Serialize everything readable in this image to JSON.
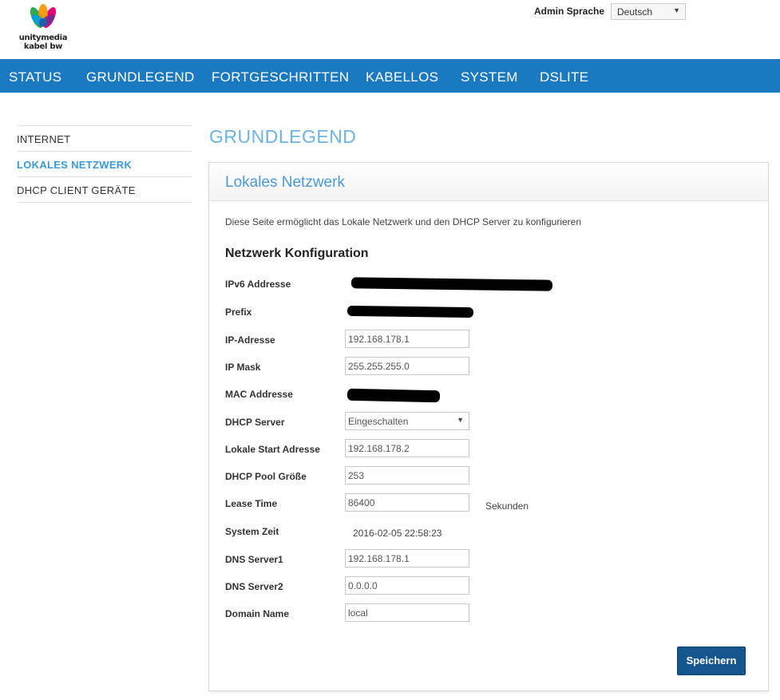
{
  "header": {
    "brand_line1": "unitymedia",
    "brand_line2": "kabel bw",
    "admin_language_label": "Admin Sprache",
    "admin_language_value": "Deutsch"
  },
  "nav": {
    "items": [
      "STATUS",
      "GRUNDLEGEND",
      "FORTGESCHRITTEN",
      "KABELLOS",
      "SYSTEM",
      "DSLITE"
    ],
    "active": "GRUNDLEGEND"
  },
  "sidebar": {
    "items": [
      "INTERNET",
      "LOKALES NETZWERK",
      "DHCP CLIENT GERÄTE"
    ],
    "active": "LOKALES NETZWERK"
  },
  "page": {
    "title": "GRUNDLEGEND",
    "panel_title": "Lokales Netzwerk",
    "description": "Diese Seite ermöglicht das Lokale Netzwerk und den DHCP Server zu konfigurieren",
    "section_title": "Netzwerk Konfiguration"
  },
  "form": {
    "ipv6_label": "IPv6 Addresse",
    "prefix_label": "Prefix",
    "ip_label": "IP-Adresse",
    "ip_value": "192.168.178.1",
    "mask_label": "IP Mask",
    "mask_value": "255.255.255.0",
    "mac_label": "MAC Addresse",
    "dhcp_label": "DHCP Server",
    "dhcp_value": "Eingeschalten",
    "start_label": "Lokale Start Adresse",
    "start_value": "192.168.178.2",
    "pool_label": "DHCP Pool Größe",
    "pool_value": "253",
    "lease_label": "Lease Time",
    "lease_value": "86400",
    "lease_unit": "Sekunden",
    "systime_label": "System Zeit",
    "systime_value": "2016-02-05 22:58:23",
    "dns1_label": "DNS Server1",
    "dns1_value": "192.168.178.1",
    "dns2_label": "DNS Server2",
    "dns2_value": "0.0.0.0",
    "domain_label": "Domain Name",
    "domain_value": "local"
  },
  "buttons": {
    "save": "Speichern"
  },
  "colors": {
    "nav_bg": "#1a79c1",
    "accent": "#6db3e0",
    "button_bg": "#16568f"
  },
  "icons": {
    "logo": "unitymedia-flower-logo",
    "dropdown": "chevron-down-icon"
  }
}
